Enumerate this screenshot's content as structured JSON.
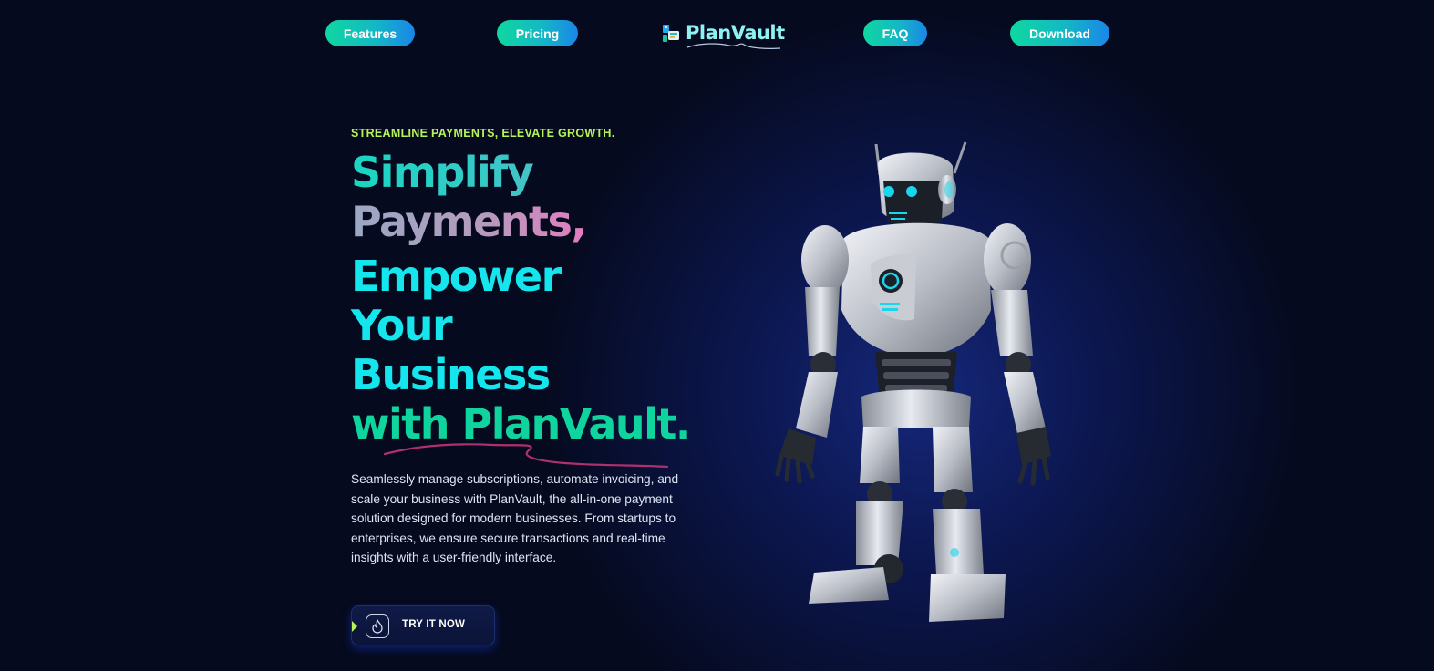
{
  "nav": {
    "items": [
      {
        "label": "Features"
      },
      {
        "label": "Pricing"
      },
      {
        "label": "FAQ"
      },
      {
        "label": "Download"
      }
    ],
    "logo_text": "PlanVault"
  },
  "hero": {
    "eyebrow": "STREAMLINE PAYMENTS, ELEVATE GROWTH.",
    "headline": {
      "line1": "Simplify",
      "line2": "Payments,",
      "line3": "Empower",
      "line4": "Your",
      "line5": "Business",
      "line6": "with PlanVault."
    },
    "description": "Seamlessly manage subscriptions, automate invoicing, and scale your business with PlanVault, the all-in-one payment solution designed for modern businesses. From startups to enterprises, we ensure secure transactions and real-time insights with a user-friendly interface.",
    "cta_label": "TRY IT NOW",
    "cta_icon": "flame-icon",
    "image_subject": "robot-illustration"
  },
  "colors": {
    "background": "#050a1e",
    "accent_green": "#10d49e",
    "accent_cyan": "#15e6ee",
    "accent_lime": "#b6f55a",
    "accent_pink": "#f45ea8",
    "button_gradient_start": "#0fd7a0",
    "button_gradient_end": "#1a86e8"
  }
}
